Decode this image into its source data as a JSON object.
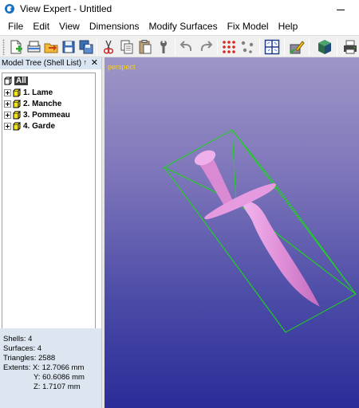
{
  "window": {
    "title": "View Expert - Untitled",
    "controls": [
      "minimize",
      "maximize",
      "close"
    ]
  },
  "menu": {
    "items": [
      "File",
      "Edit",
      "View",
      "Dimensions",
      "Modify Surfaces",
      "Fix Model",
      "Help"
    ]
  },
  "toolbar": {
    "buttons": [
      {
        "name": "new-icon"
      },
      {
        "name": "open-icon"
      },
      {
        "name": "import-icon"
      },
      {
        "name": "save-icon"
      },
      {
        "name": "save-as-icon"
      },
      {
        "name": "cut-icon"
      },
      {
        "name": "copy-icon"
      },
      {
        "name": "paste-icon"
      },
      {
        "name": "wrench-icon"
      },
      {
        "name": "undo-icon"
      },
      {
        "name": "redo-icon"
      },
      {
        "name": "grid-points-icon"
      },
      {
        "name": "points-icon"
      },
      {
        "name": "views-grid-icon"
      },
      {
        "name": "edit-model-icon"
      },
      {
        "name": "shading-icon"
      },
      {
        "name": "print-icon"
      }
    ]
  },
  "panel": {
    "title": "Model Tree (Shell List)",
    "pin_glyph": "↑",
    "close_glyph": "✕",
    "tree": {
      "root_label": "All",
      "items": [
        {
          "label": "1. Lame"
        },
        {
          "label": "2. Manche"
        },
        {
          "label": "3. Pommeau"
        },
        {
          "label": "4. Garde"
        }
      ]
    }
  },
  "stats": {
    "shells": "Shells: 4",
    "surfaces": "Surfaces: 4",
    "triangles": "Triangles: 2588",
    "extents_x": "Extents:  X: 12.7066 mm",
    "extents_y": "Y: 60.6086 mm",
    "extents_z": "Z: 1.7107 mm"
  },
  "viewport": {
    "label": "perspect",
    "label_color": "#ffd400",
    "model_color": "#e090d8",
    "bbox_color": "#1fd21f",
    "background_top": "#9e96c6",
    "background_bottom": "#2b2c98"
  }
}
